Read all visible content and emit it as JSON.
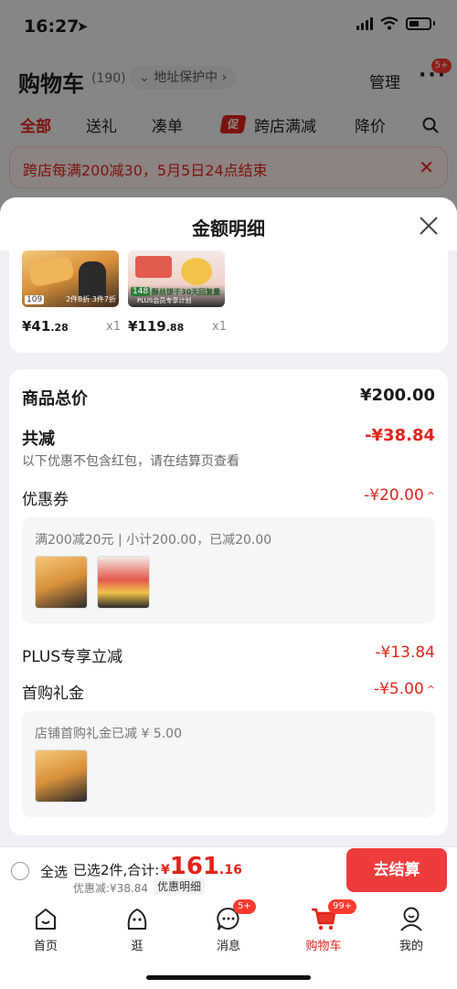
{
  "status_bar": {
    "time": "16:27"
  },
  "header": {
    "title": "购物车",
    "count": "(190)",
    "address": "地址保护中",
    "manage_label": "管理",
    "more_badge": "5+"
  },
  "filter_tabs": [
    {
      "label": "全部"
    },
    {
      "label": "送礼"
    },
    {
      "label": "凑单"
    },
    {
      "label": "跨店满减",
      "tag": "促"
    },
    {
      "label": "降价"
    }
  ],
  "promo_banner": "跨店每满200减30，5月5日24点结束",
  "sheet": {
    "title": "金额明细",
    "products": [
      {
        "price_int": "¥41",
        "price_dec": ".28",
        "qty": "x1",
        "thumb_tag": "109",
        "thumb_note": "2件8折 3件7折"
      },
      {
        "price_int": "¥119",
        "price_dec": ".88",
        "qty": "x1",
        "thumb_tag": "148",
        "thumb_note": "酥丝饼干30天回复量",
        "thumb_plus": "PLUS会员专享计划"
      }
    ],
    "total_label": "商品总价",
    "total_value": "¥200.00",
    "reduce_label": "共减",
    "reduce_value": "-¥38.84",
    "reduce_note": "以下优惠不包含红包，请在结算页查看",
    "coupon_label": "优惠券",
    "coupon_value": "-¥20.00",
    "coupon_detail": "满200减20元 | 小计200.00，已减20.00",
    "plus_label": "PLUS专享立减",
    "plus_value": "-¥13.84",
    "first_label": "首购礼金",
    "first_value": "-¥5.00",
    "first_detail": "店铺首购礼金已减 ¥ 5.00"
  },
  "checkout": {
    "select_all": "全选",
    "selected": "已选2件,合计:",
    "currency": "¥",
    "total_int": "161",
    "total_dec": ".16",
    "discount": "优惠减:¥38.84",
    "detail_label": "优惠明细",
    "button": "去结算"
  },
  "tabbar": [
    {
      "label": "首页",
      "icon": "home-icon"
    },
    {
      "label": "逛",
      "icon": "browse-icon"
    },
    {
      "label": "消息",
      "icon": "message-icon",
      "badge": "5+"
    },
    {
      "label": "购物车",
      "icon": "cart-icon",
      "badge": "99+",
      "active": true
    },
    {
      "label": "我的",
      "icon": "profile-icon"
    }
  ],
  "colors": {
    "accent": "#e2231a",
    "button": "#ee3b3b"
  }
}
